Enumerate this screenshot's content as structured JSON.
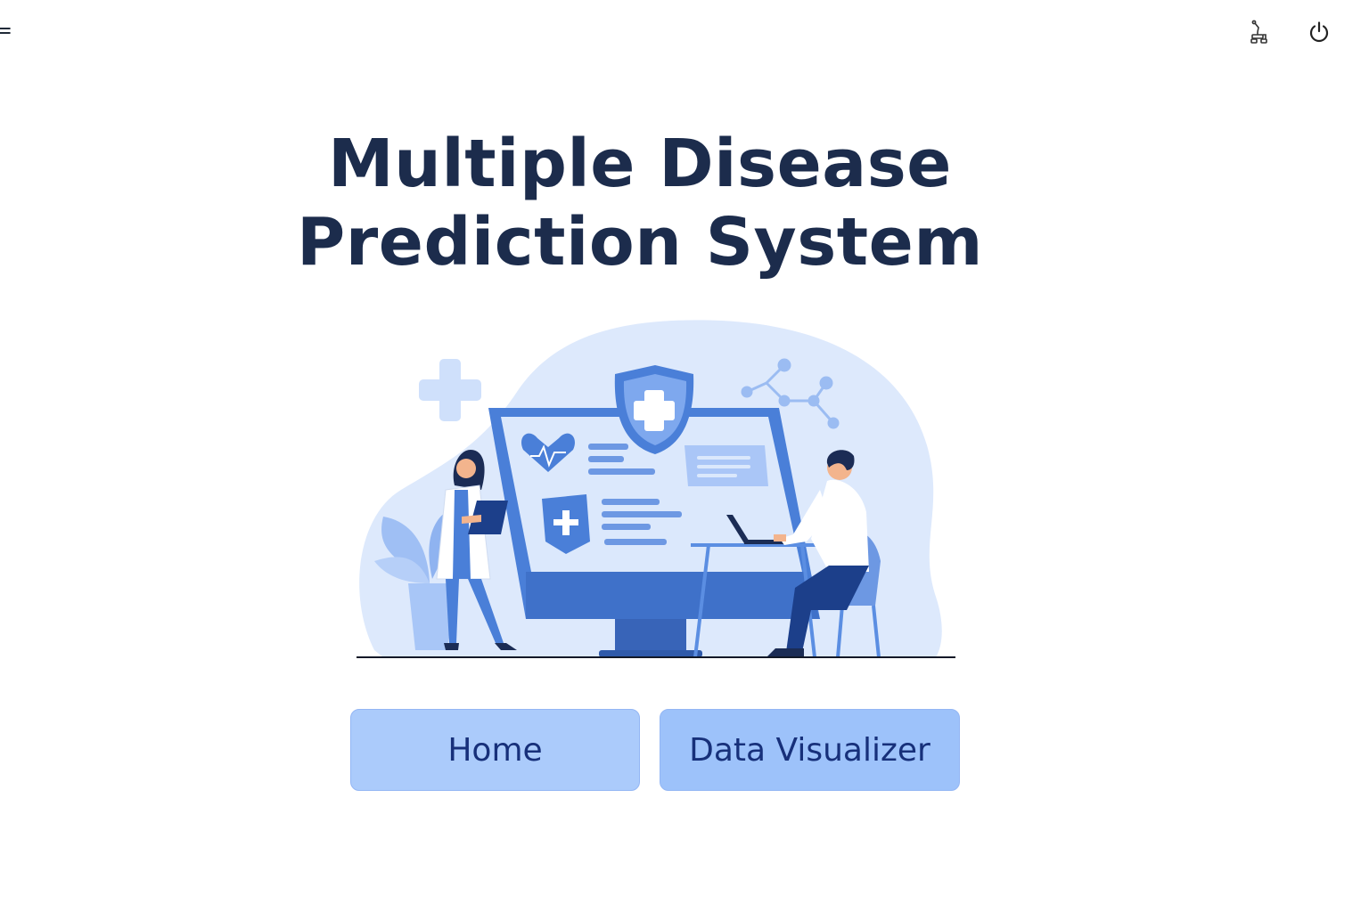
{
  "header": {
    "menu_glyph": "=",
    "icons": [
      "deploy-icon",
      "power-icon"
    ]
  },
  "main": {
    "title": "Multiple Disease Prediction System"
  },
  "nav": {
    "home_label": "Home",
    "visualizer_label": "Data Visualizer"
  },
  "colors": {
    "title": "#1c2c4c",
    "accent_blue": "#4a7fd8",
    "button_home": "#abcbfb",
    "button_viz": "#9dc2fa",
    "button_text": "#17307a"
  }
}
